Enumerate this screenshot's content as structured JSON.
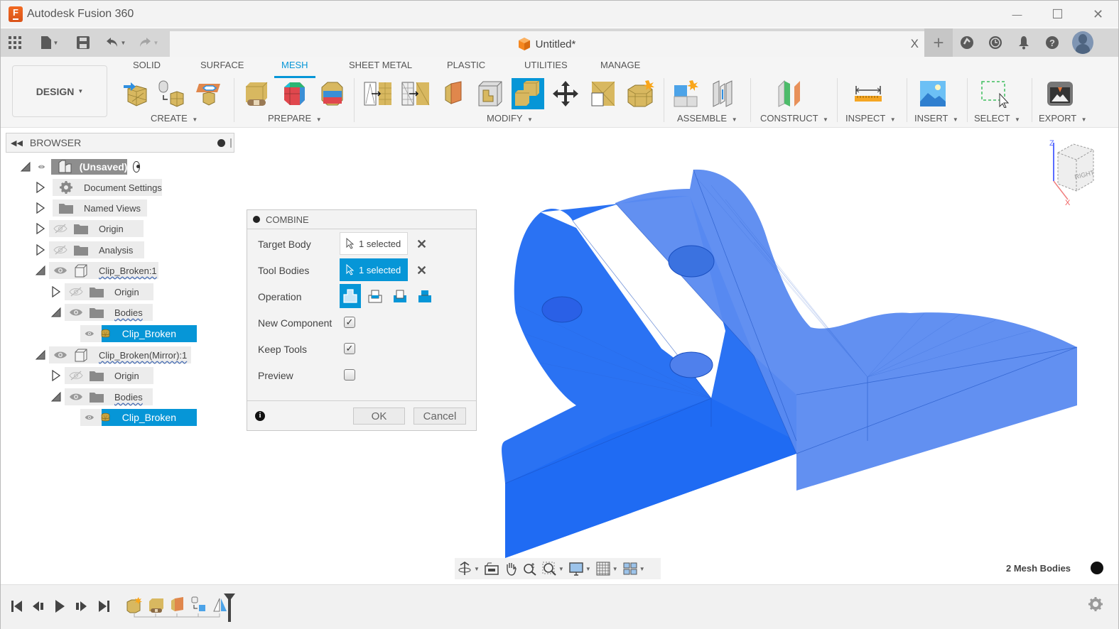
{
  "app": {
    "title": "Autodesk Fusion 360",
    "logo_letter": "F",
    "window_controls": {
      "minimize": "—",
      "maximize": "☐",
      "close": "✕"
    }
  },
  "quick_access": {
    "icons": [
      "apps-grid-icon",
      "file-icon",
      "save-icon",
      "undo-icon",
      "redo-icon"
    ],
    "document_tab": {
      "title": "Untitled*",
      "close": "X"
    },
    "right_icons": [
      "new-tab-plus-icon",
      "job-status-icon",
      "history-icon",
      "notifications-icon",
      "help-icon",
      "user-avatar"
    ]
  },
  "toolbar": {
    "workspace": "DESIGN",
    "tabs": [
      {
        "label": "SOLID",
        "active": false
      },
      {
        "label": "SURFACE",
        "active": false
      },
      {
        "label": "MESH",
        "active": true
      },
      {
        "label": "SHEET METAL",
        "active": false
      },
      {
        "label": "PLASTIC",
        "active": false
      },
      {
        "label": "UTILITIES",
        "active": false
      },
      {
        "label": "MANAGE",
        "active": false
      }
    ],
    "groups": [
      {
        "label": "CREATE",
        "tools": [
          "insert-mesh-icon",
          "tessellate-icon",
          "create-face-groups-icon"
        ]
      },
      {
        "label": "PREPARE",
        "tools": [
          "repair-icon",
          "generate-face-groups-icon",
          "combine-face-groups-icon"
        ]
      },
      {
        "label": "MODIFY",
        "tools": [
          "remesh-icon",
          "reduce-icon",
          "plane-cut-icon",
          "shell-icon",
          "combine-icon",
          "move-icon",
          "reverse-normal-icon",
          "convert-mesh-icon"
        ],
        "active_tool": "combine-icon"
      },
      {
        "label": "ASSEMBLE",
        "tools": [
          "new-component-icon",
          "joint-icon"
        ]
      },
      {
        "label": "CONSTRUCT",
        "tools": [
          "offset-plane-icon"
        ]
      },
      {
        "label": "INSPECT",
        "tools": [
          "measure-icon"
        ]
      },
      {
        "label": "INSERT",
        "tools": [
          "insert-image-icon"
        ]
      },
      {
        "label": "SELECT",
        "tools": [
          "window-select-icon"
        ]
      },
      {
        "label": "EXPORT",
        "tools": [
          "3d-print-icon"
        ]
      }
    ]
  },
  "browser": {
    "title": "BROWSER",
    "tree": [
      {
        "label": "(Unsaved)",
        "level": 0,
        "expanded": true,
        "visible": true,
        "type": "root"
      },
      {
        "label": "Document Settings",
        "level": 1,
        "expanded": false,
        "type": "settings"
      },
      {
        "label": "Named Views",
        "level": 1,
        "expanded": false,
        "type": "folder"
      },
      {
        "label": "Origin",
        "level": 1,
        "expanded": false,
        "visible": false,
        "type": "folder"
      },
      {
        "label": "Analysis",
        "level": 1,
        "expanded": false,
        "visible": false,
        "type": "folder"
      },
      {
        "label": "Clip_Broken:1",
        "level": 1,
        "expanded": true,
        "visible": true,
        "type": "component"
      },
      {
        "label": "Origin",
        "level": 2,
        "expanded": false,
        "visible": false,
        "type": "folder"
      },
      {
        "label": "Bodies",
        "level": 2,
        "expanded": true,
        "visible": true,
        "type": "folder"
      },
      {
        "label": "Clip_Broken",
        "level": 3,
        "visible": true,
        "type": "mesh-body",
        "selected": true
      },
      {
        "label": "Clip_Broken(Mirror):1",
        "level": 1,
        "expanded": true,
        "visible": true,
        "type": "component"
      },
      {
        "label": "Origin",
        "level": 2,
        "expanded": false,
        "visible": false,
        "type": "folder"
      },
      {
        "label": "Bodies",
        "level": 2,
        "expanded": true,
        "visible": true,
        "type": "folder"
      },
      {
        "label": "Clip_Broken",
        "level": 3,
        "visible": true,
        "type": "mesh-body",
        "selected": true
      }
    ]
  },
  "combine_dialog": {
    "title": "COMBINE",
    "target_body": {
      "label": "Target Body",
      "value": "1 selected"
    },
    "tool_bodies": {
      "label": "Tool Bodies",
      "value": "1 selected"
    },
    "operation": {
      "label": "Operation",
      "options": [
        "Join",
        "Cut",
        "Intersect",
        "Merge"
      ],
      "selected": "Join"
    },
    "new_component": {
      "label": "New Component",
      "checked": true
    },
    "keep_tools": {
      "label": "Keep Tools",
      "checked": true
    },
    "preview": {
      "label": "Preview",
      "checked": false
    },
    "check_glyph": "✓",
    "ok": "OK",
    "cancel": "Cancel"
  },
  "viewport": {
    "viewcube": {
      "face": "RIGHT",
      "axis_z": "Z",
      "axis_x": "X"
    },
    "status": "2 Mesh Bodies",
    "model_color": "#1a66f0"
  },
  "colors": {
    "accent": "#0696d7",
    "mesh_blue": "#1a66f0",
    "brand_orange": "#f26a21"
  }
}
